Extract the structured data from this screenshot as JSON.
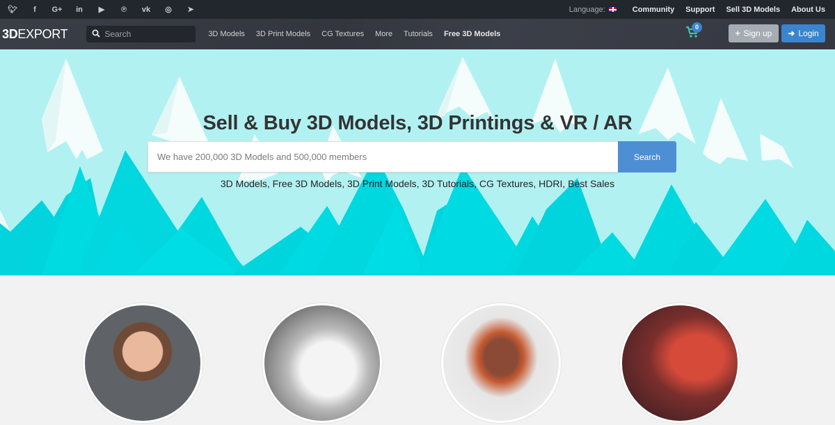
{
  "topbar": {
    "social": [
      {
        "name": "twitter-icon",
        "glyph": "🐦︎"
      },
      {
        "name": "facebook-icon",
        "glyph": "f"
      },
      {
        "name": "google-plus-icon",
        "glyph": "G+"
      },
      {
        "name": "linkedin-icon",
        "glyph": "in"
      },
      {
        "name": "youtube-icon",
        "glyph": "▶"
      },
      {
        "name": "pinterest-icon",
        "glyph": "℗"
      },
      {
        "name": "vk-icon",
        "glyph": "vk"
      },
      {
        "name": "instagram-icon",
        "glyph": "◎"
      },
      {
        "name": "telegram-icon",
        "glyph": "➤"
      }
    ],
    "language_label": "Language:",
    "links": [
      "Community",
      "Support",
      "Sell 3D Models",
      "About Us"
    ]
  },
  "navbar": {
    "logo_bold": "3D",
    "logo_rest": "EXPORT",
    "search_placeholder": "Search",
    "links": [
      "3D Models",
      "3D Print Models",
      "CG Textures",
      "More",
      "Tutorials",
      "Free 3D Models"
    ],
    "cart_count": "0",
    "signup_label": "Sign up",
    "login_label": "Login"
  },
  "hero": {
    "title": "Sell & Buy 3D Models, 3D Printings & VR / AR",
    "search_placeholder": "We have 200,000 3D Models and 500,000 members",
    "search_button": "Search",
    "links": [
      "3D Models",
      "Free 3D Models",
      "3D Print Models",
      "3D Tutorials",
      "CG Textures",
      "HDRI",
      "Best Sales"
    ]
  },
  "featured": [
    {
      "name": "woman-character-model"
    },
    {
      "name": "rhino-creature-model"
    },
    {
      "name": "armored-robot-model"
    },
    {
      "name": "lava-dragon-model"
    }
  ]
}
